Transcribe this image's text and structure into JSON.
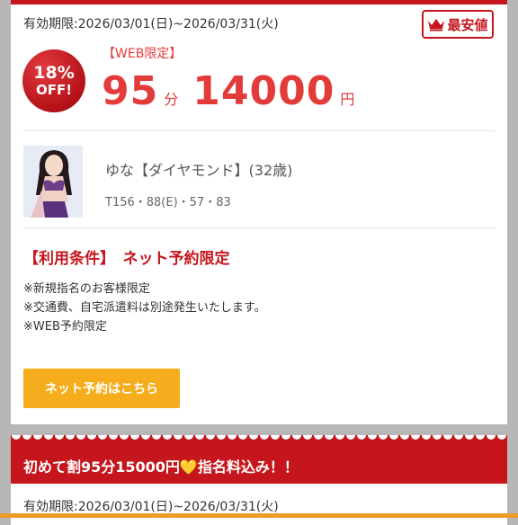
{
  "offer": {
    "validity": "有効期限:2026/03/01(日)~2026/03/31(火)",
    "best_badge": "最安値",
    "discount_pct": "18%",
    "discount_off": "OFF!",
    "web_tag": "【WEB限定】",
    "minutes": "95",
    "minutes_unit": "分",
    "price": "14000",
    "price_unit": "円"
  },
  "girl": {
    "name": "ゆな【ダイヤモンド】(32歳)",
    "stats": "T156・88(E)・57・83"
  },
  "conditions": {
    "title": "【利用条件】　ネット予約限定",
    "items": [
      "※新規指名のお客様限定",
      "※交通費、自宅派遣料は別途発生いたします。",
      "※WEB予約限定"
    ]
  },
  "reserve_button": "ネット予約はこちら",
  "next_offer": {
    "title": "初めて割95分15000円💛指名料込み！！",
    "validity": "有効期限:2026/03/01(日)~2026/03/31(火)"
  },
  "colors": {
    "accent_red": "#c4161c",
    "price_red": "#e33a3a",
    "button_orange": "#f6ad1d"
  }
}
